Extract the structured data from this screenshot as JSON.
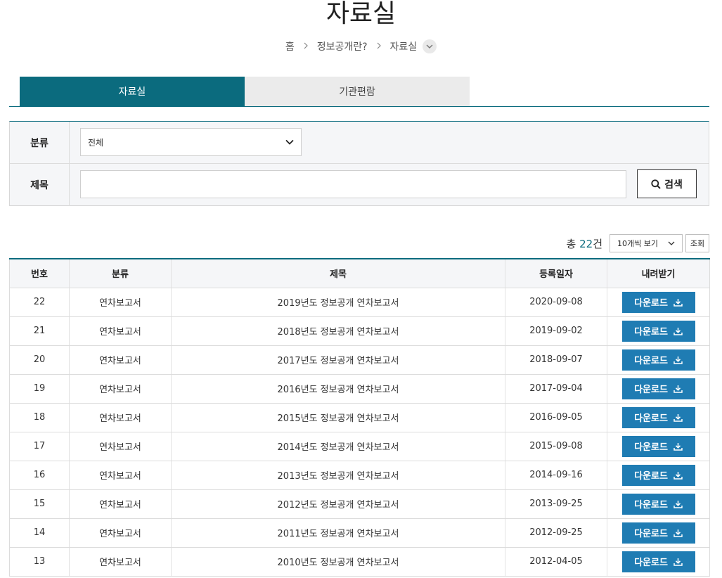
{
  "page": {
    "title": "자료실"
  },
  "breadcrumb": {
    "home": "홈",
    "parent": "정보공개란?",
    "current": "자료실"
  },
  "tabs": [
    {
      "label": "자료실",
      "active": true
    },
    {
      "label": "기관편람",
      "active": false
    }
  ],
  "search": {
    "category_label": "분류",
    "category_value": "전체",
    "title_label": "제목",
    "title_value": "",
    "search_button": "검색"
  },
  "list_info": {
    "total_prefix": "총",
    "total_count": "22",
    "total_suffix": "건",
    "per_page": "10개씩 보기",
    "view_button": "조회"
  },
  "table": {
    "headers": [
      "번호",
      "분류",
      "제목",
      "등록일자",
      "내려받기"
    ],
    "download_label": "다운로드",
    "rows": [
      {
        "no": "22",
        "category": "연차보고서",
        "title": "2019년도 정보공개 연차보고서",
        "date": "2020-09-08"
      },
      {
        "no": "21",
        "category": "연차보고서",
        "title": "2018년도 정보공개 연차보고서",
        "date": "2019-09-02"
      },
      {
        "no": "20",
        "category": "연차보고서",
        "title": "2017년도 정보공개 연차보고서",
        "date": "2018-09-07"
      },
      {
        "no": "19",
        "category": "연차보고서",
        "title": "2016년도 정보공개 연차보고서",
        "date": "2017-09-04"
      },
      {
        "no": "18",
        "category": "연차보고서",
        "title": "2015년도 정보공개 연차보고서",
        "date": "2016-09-05"
      },
      {
        "no": "17",
        "category": "연차보고서",
        "title": "2014년도 정보공개 연차보고서",
        "date": "2015-09-08"
      },
      {
        "no": "16",
        "category": "연차보고서",
        "title": "2013년도 정보공개 연차보고서",
        "date": "2014-09-16"
      },
      {
        "no": "15",
        "category": "연차보고서",
        "title": "2012년도 정보공개 연차보고서",
        "date": "2013-09-25"
      },
      {
        "no": "14",
        "category": "연차보고서",
        "title": "2011년도 정보공개 연차보고서",
        "date": "2012-09-25"
      },
      {
        "no": "13",
        "category": "연차보고서",
        "title": "2010년도 정보공개 연차보고서",
        "date": "2012-04-05"
      }
    ]
  },
  "colors": {
    "accent": "#0b6b7e",
    "download_button": "#1f7cb3"
  },
  "icons": {
    "breadcrumb_sep": "chevron-right-icon",
    "search": "search-icon",
    "download": "download-icon",
    "select": "chevron-down-icon"
  }
}
